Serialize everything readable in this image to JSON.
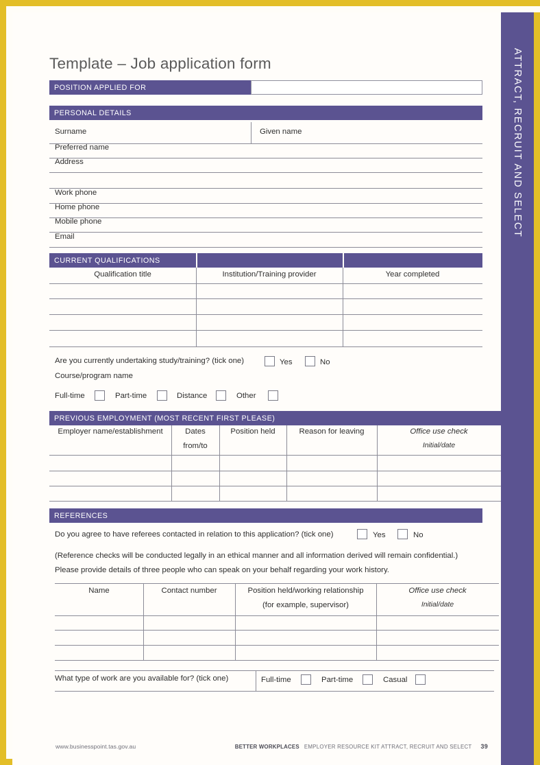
{
  "document": {
    "title": "Template – Job application form",
    "side_tab_label": "ATTRACT, RECRUIT AND SELECT"
  },
  "position_applied": {
    "bar_label": "POSITION APPLIED FOR",
    "value": ""
  },
  "personal_details": {
    "bar_label": "PERSONAL DETAILS",
    "fields": [
      {
        "label": "Surname",
        "value": ""
      },
      {
        "label": "Given name",
        "value": ""
      },
      {
        "label": "Preferred name",
        "value": ""
      },
      {
        "label": "Address",
        "value": ""
      },
      {
        "label": "Work phone",
        "value": ""
      },
      {
        "label": "Home phone",
        "value": ""
      },
      {
        "label": "Mobile phone",
        "value": ""
      },
      {
        "label": "Email",
        "value": ""
      }
    ]
  },
  "qualifications": {
    "bar_label": "CURRENT QUALIFICATIONS",
    "columns": [
      "Qualification title",
      "Institution/Training provider",
      "Year completed"
    ],
    "rows": [
      [
        "",
        "",
        ""
      ],
      [
        "",
        "",
        ""
      ],
      [
        "",
        "",
        ""
      ],
      [
        "",
        "",
        ""
      ]
    ],
    "study_question": "Are you currently undertaking study/training? (tick one)",
    "study_options": [
      "Yes",
      "No"
    ],
    "course_label": "Course/program name",
    "course_value": "",
    "mode_options": [
      "Full-time",
      "Part-time",
      "Distance",
      "Other"
    ]
  },
  "previous_employment": {
    "bar_label": "PREVIOUS EMPLOYMENT (MOST RECENT FIRST PLEASE)",
    "columns": [
      {
        "line1": "Employer name/establishment",
        "line2": ""
      },
      {
        "line1": "Dates",
        "line2": "from/to"
      },
      {
        "line1": "Position held",
        "line2": ""
      },
      {
        "line1": "Reason for leaving",
        "line2": ""
      },
      {
        "line1": "Office use check",
        "line2": "Initial/date"
      }
    ],
    "rows": [
      [
        "",
        "",
        "",
        "",
        ""
      ],
      [
        "",
        "",
        "",
        "",
        ""
      ],
      [
        "",
        "",
        "",
        "",
        ""
      ]
    ]
  },
  "references": {
    "bar_label": "REFERENCES",
    "consent_question": "Do you agree to have referees contacted in relation to this application? (tick one)",
    "consent_options": [
      "Yes",
      "No"
    ],
    "note_line1": "(Reference checks will be conducted legally in an ethical manner and all information derived will remain confidential.)",
    "note_line2": "Please provide details of three people who can speak on your behalf regarding your work history.",
    "columns": [
      {
        "line1": "Name",
        "line2": ""
      },
      {
        "line1": "Contact number",
        "line2": ""
      },
      {
        "line1": "Position held/working relationship",
        "line2": "(for example, supervisor)"
      },
      {
        "line1": "Office use check",
        "line2": "Initial/date"
      }
    ],
    "rows": [
      [
        "",
        "",
        "",
        ""
      ],
      [
        "",
        "",
        "",
        ""
      ],
      [
        "",
        "",
        "",
        ""
      ]
    ]
  },
  "availability": {
    "question": "What type of work are you available for? (tick one)",
    "options": [
      "Full-time",
      "Part-time",
      "Casual"
    ]
  },
  "footer": {
    "url": "www.businesspoint.tas.gov.au",
    "brand": "BETTER WORKPLACES",
    "kit": "EMPLOYER RESOURCE KIT ATTRACT, RECRUIT AND SELECT",
    "page_number": "39"
  },
  "colors": {
    "purple": "#5b5391",
    "gold": "#e3be28",
    "rule": "#8b8b97"
  }
}
